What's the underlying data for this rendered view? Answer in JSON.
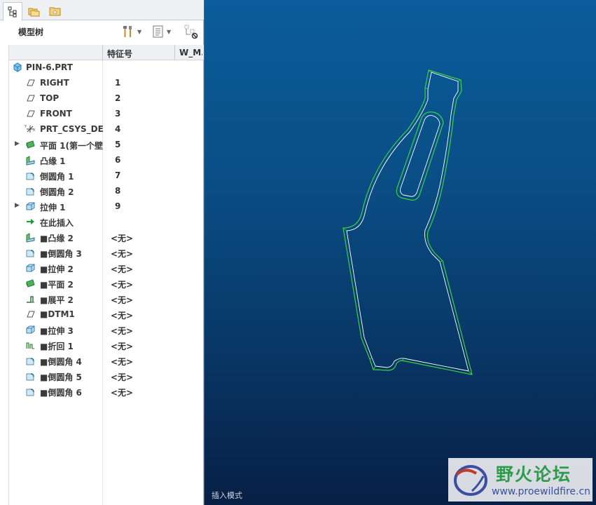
{
  "tabs": [
    {
      "name": "model-tree-tab",
      "icon": "tree-icon"
    },
    {
      "name": "folder-browser-tab",
      "icon": "folders-icon"
    },
    {
      "name": "favorites-tab",
      "icon": "favorites-folder-icon"
    }
  ],
  "toolbar": {
    "title": "模型树",
    "settings_icon": "tools-icon",
    "show_icon": "list-settings-icon",
    "filter_icon": "tree-filter-icon"
  },
  "columns": {
    "name": "",
    "feature_number": "特征号",
    "third": "W_M..."
  },
  "tree": {
    "root": {
      "label": "PIN-6.PRT",
      "icon": "part-icon"
    },
    "items": [
      {
        "label": "RIGHT",
        "num": "1",
        "icon": "datum-plane-icon",
        "expand": false
      },
      {
        "label": "TOP",
        "num": "2",
        "icon": "datum-plane-icon",
        "expand": false
      },
      {
        "label": "FRONT",
        "num": "3",
        "icon": "datum-plane-icon",
        "expand": false
      },
      {
        "label": "PRT_CSYS_DEF",
        "num": "4",
        "icon": "coordinate-system-icon",
        "expand": false
      },
      {
        "label": "平面 1(第一个壁",
        "num": "5",
        "icon": "sheetmetal-wall-icon",
        "expand": true
      },
      {
        "label": "凸缘 1",
        "num": "6",
        "icon": "flange-icon",
        "expand": false
      },
      {
        "label": "倒圆角 1",
        "num": "7",
        "icon": "round-icon",
        "expand": false
      },
      {
        "label": "倒圆角 2",
        "num": "8",
        "icon": "round-icon",
        "expand": false
      },
      {
        "label": "拉伸 1",
        "num": "9",
        "icon": "extrude-icon",
        "expand": true
      },
      {
        "label": "在此插入",
        "num": "",
        "icon": "insert-here-arrow-icon",
        "expand": false
      },
      {
        "label": "■凸缘 2",
        "num": "<无>",
        "icon": "flange-icon",
        "expand": false
      },
      {
        "label": "■倒圆角 3",
        "num": "<无>",
        "icon": "round-icon",
        "expand": false
      },
      {
        "label": "■拉伸 2",
        "num": "<无>",
        "icon": "extrude-icon",
        "expand": false
      },
      {
        "label": "■平面 2",
        "num": "<无>",
        "icon": "sheetmetal-wall-icon",
        "expand": false
      },
      {
        "label": "■展平 2",
        "num": "<无>",
        "icon": "unbend-icon",
        "expand": false
      },
      {
        "label": "■DTM1",
        "num": "<无>",
        "icon": "datum-plane-icon",
        "expand": false
      },
      {
        "label": "■拉伸 3",
        "num": "<无>",
        "icon": "extrude-icon",
        "expand": false
      },
      {
        "label": "■折回 1",
        "num": "<无>",
        "icon": "bend-back-icon",
        "expand": false
      },
      {
        "label": "■倒圆角 4",
        "num": "<无>",
        "icon": "round-icon",
        "expand": false
      },
      {
        "label": "■倒圆角 5",
        "num": "<无>",
        "icon": "round-icon",
        "expand": false
      },
      {
        "label": "■倒圆角 6",
        "num": "<无>",
        "icon": "round-icon",
        "expand": false
      }
    ]
  },
  "viewport": {
    "status": "插入模式",
    "edge_color": "#3cd23c",
    "highlight_color": "#ffffff"
  },
  "watermark": {
    "title": "野火论坛",
    "url": "www.proewildfire.cn"
  },
  "colors": {
    "viewport_top": "#0b5d9b",
    "viewport_bottom": "#071f45",
    "wall_icon": "#3aa64a",
    "datum_icon": "#555555"
  }
}
